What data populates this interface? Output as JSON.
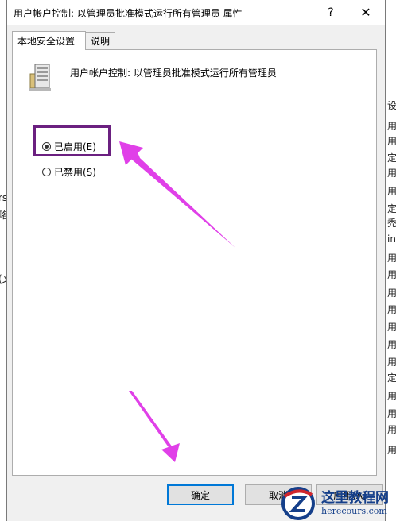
{
  "dialog": {
    "title": "用户帐户控制: 以管理员批准模式运行所有管理员 属性",
    "help_glyph": "?",
    "close_glyph": "✕"
  },
  "tabs": [
    {
      "label": "本地安全设置",
      "active": true
    },
    {
      "label": "说明",
      "active": false
    }
  ],
  "policy": {
    "name": "用户帐户控制: 以管理员批准模式运行所有管理员",
    "icon": "server-policy-icon"
  },
  "options": [
    {
      "label": "已启用(E)",
      "checked": true
    },
    {
      "label": "已禁用(S)",
      "checked": false
    }
  ],
  "buttons": {
    "ok": "确定",
    "cancel": "取消",
    "apply": "应用(A)"
  },
  "watermark": {
    "name": "这里教程网",
    "url": "herecours.com"
  },
  "background_left": [
    "rs",
    "略",
    "(文"
  ],
  "background_right": [
    "设",
    "用",
    "用",
    "定",
    "用",
    "用",
    "定",
    "禿",
    "in",
    "用",
    "用",
    "用",
    "用",
    "用",
    "用",
    "用",
    "定",
    "用",
    "用",
    "用",
    "用"
  ],
  "colors": {
    "highlight_border": "#6b2080",
    "annotation_arrow": "#e040e8",
    "ok_button_focus": "#0078d7",
    "watermark_blue": "#153f8a"
  }
}
